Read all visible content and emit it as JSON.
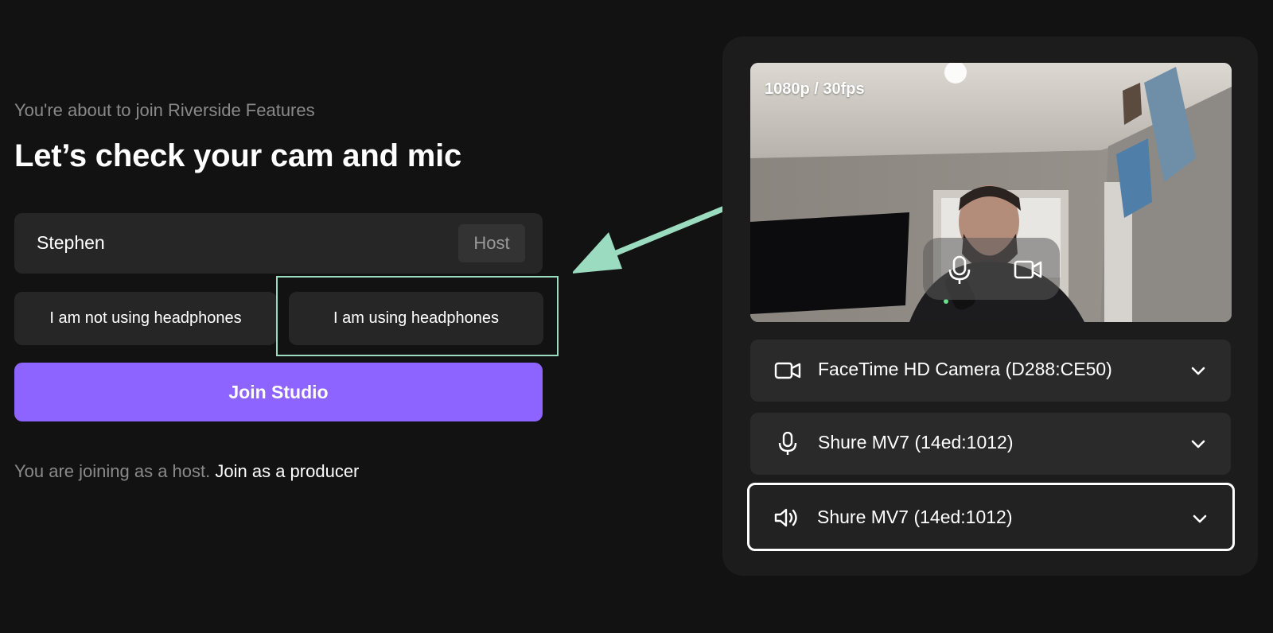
{
  "intro": {
    "subtitle": "You're about to join Riverside Features",
    "title": "Let’s check your cam and mic"
  },
  "name_field": {
    "value": "Stephen",
    "role": "Host"
  },
  "headphones": {
    "not_using": "I am not using headphones",
    "using": "I am using headphones"
  },
  "join_button": "Join Studio",
  "footer": {
    "text": "You are joining as a host.",
    "link": "Join as a producer"
  },
  "preview": {
    "resolution": "1080p / 30fps"
  },
  "devices": {
    "camera": "FaceTime HD Camera (D288:CE50)",
    "microphone": "Shure MV7 (14ed:1012)",
    "speaker": "Shure MV7 (14ed:1012)"
  },
  "colors": {
    "accent": "#8d64ff",
    "highlight": "#9bdcc0",
    "background": "#121212"
  }
}
